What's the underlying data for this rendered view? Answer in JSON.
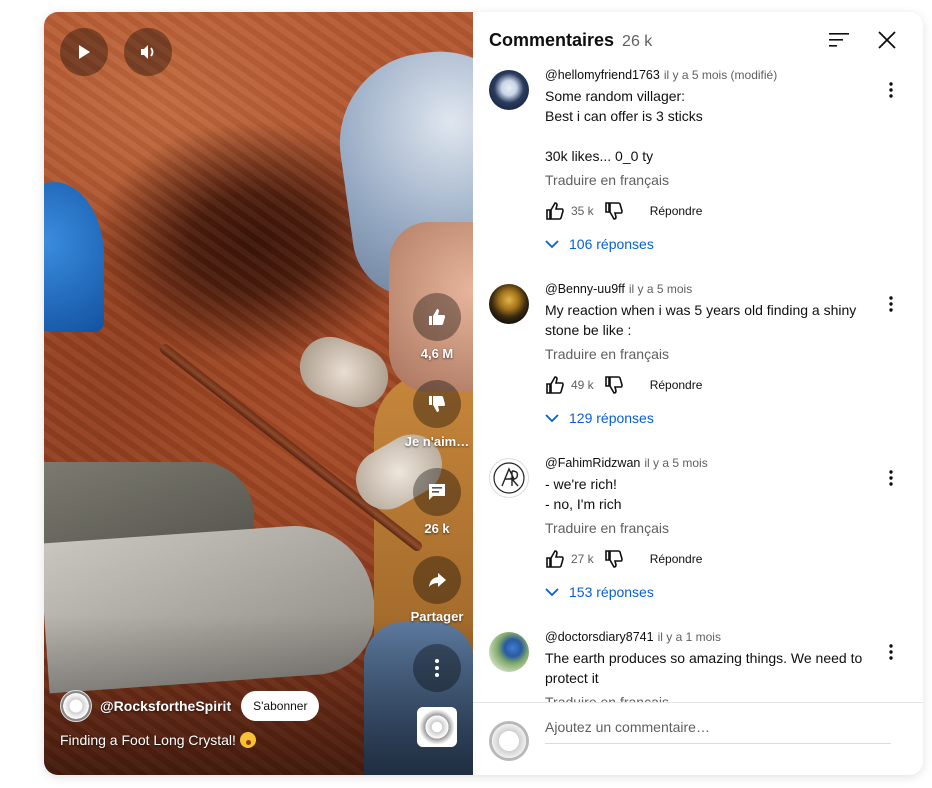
{
  "video": {
    "like_count": "4,6 M",
    "dislike_label": "Je n'aim…",
    "comment_count": "26 k",
    "share_label": "Partager",
    "channel_name": "@RocksfortheSpirit",
    "subscribe_label": "S'abonner",
    "title": "Finding a Foot Long Crystal!"
  },
  "comments_panel": {
    "title": "Commentaires",
    "count": "26 k",
    "input_placeholder": "Ajoutez un commentaire…",
    "comments": [
      {
        "author": "@hellomyfriend1763",
        "time": "il y a 5 mois (modifié)",
        "text": "Some random villager:\nBest i can offer is 3 sticks\n\n30k likes... 0_0 ty",
        "translate": "Traduire en français",
        "likes": "35 k",
        "reply": "Répondre",
        "replies": "106 réponses"
      },
      {
        "author": "@Benny-uu9ff",
        "time": "il y a 5 mois",
        "text": "My reaction when i was 5 years old finding a shiny stone be like :",
        "translate": "Traduire en français",
        "likes": "49 k",
        "reply": "Répondre",
        "replies": "129 réponses"
      },
      {
        "author": "@FahimRidzwan",
        "time": "il y a 5 mois",
        "text": "- we're rich!\n- no, I'm rich",
        "translate": "Traduire en français",
        "likes": "27 k",
        "reply": "Répondre",
        "replies": "153 réponses"
      },
      {
        "author": "@doctorsdiary8741",
        "time": "il y a 1 mois",
        "text": "The earth produces so amazing things. We need to protect it",
        "translate": "Traduire en français"
      }
    ]
  }
}
